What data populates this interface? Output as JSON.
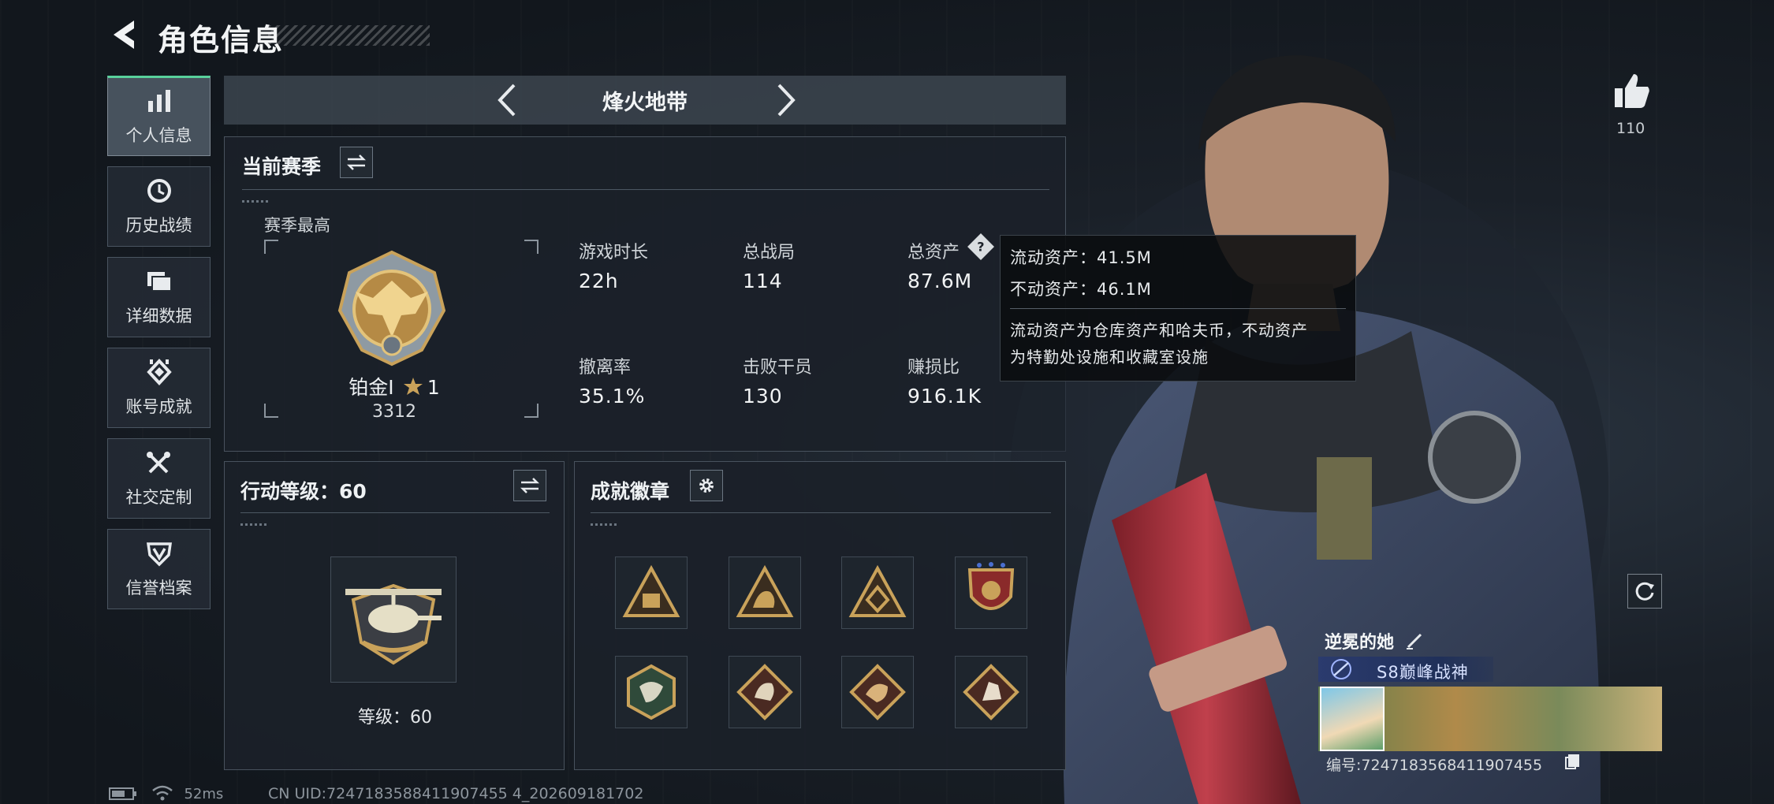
{
  "header": {
    "title": "角色信息"
  },
  "sidebar": {
    "items": [
      {
        "label": "个人信息",
        "icon": "bar-chart-icon",
        "active": true
      },
      {
        "label": "历史战绩",
        "icon": "history-icon"
      },
      {
        "label": "详细数据",
        "icon": "folder-icon"
      },
      {
        "label": "账号成就",
        "icon": "achievement-icon"
      },
      {
        "label": "社交定制",
        "icon": "tools-icon"
      },
      {
        "label": "信誉档案",
        "icon": "shield-icon"
      }
    ]
  },
  "mode_bar": {
    "title": "烽火地带"
  },
  "season": {
    "title": "当前赛季",
    "best_label": "赛季最高",
    "rank_name": "铂金Ⅰ",
    "rank_stars": "1",
    "rank_points": "3312",
    "stats": [
      {
        "label": "游戏时长",
        "value": "22h"
      },
      {
        "label": "总战局",
        "value": "114"
      },
      {
        "label": "总资产",
        "value": "87.6M"
      },
      {
        "label": "撤离率",
        "value": "35.1%"
      },
      {
        "label": "击败干员",
        "value": "130"
      },
      {
        "label": "赚损比",
        "value": "916.1K"
      }
    ]
  },
  "tooltip": {
    "liquid": "流动资产：41.5M",
    "fixed": "不动资产：46.1M",
    "desc_line1": "流动资产为仓库资产和哈夫币，不动资产",
    "desc_line2": "为特勤处设施和收藏室设施"
  },
  "action_level": {
    "title": "行动等级：60",
    "level_text": "等级：60"
  },
  "badges": {
    "title": "成就徽章",
    "items": [
      "badge-1",
      "badge-2",
      "badge-3",
      "badge-4",
      "badge-5",
      "badge-6",
      "badge-7",
      "badge-8"
    ]
  },
  "profile": {
    "likes": "110",
    "player_name": "逆冕的她",
    "player_title": "S8巅峰战神",
    "id_text": "编号:7247183568411907455"
  },
  "status": {
    "ping": "52ms",
    "uid": "CN UID:7247183588411907455 4_202609181702"
  },
  "colors": {
    "accent": "#58d19b",
    "gold": "#c9a25a",
    "panel": "#1b2129"
  }
}
